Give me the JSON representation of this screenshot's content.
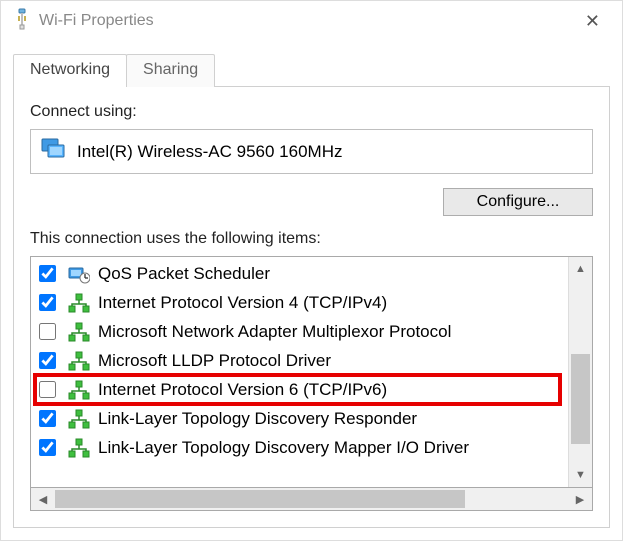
{
  "window": {
    "title": "Wi-Fi Properties",
    "close_glyph": "✕"
  },
  "tabs": {
    "networking": "Networking",
    "sharing": "Sharing"
  },
  "connect_label": "Connect using:",
  "adapter_name": "Intel(R) Wireless-AC 9560 160MHz",
  "configure_label": "Configure...",
  "items_label": "This connection uses the following items:",
  "items": [
    {
      "checked": true,
      "icon": "qos",
      "label": "QoS Packet Scheduler"
    },
    {
      "checked": true,
      "icon": "proto",
      "label": "Internet Protocol Version 4 (TCP/IPv4)"
    },
    {
      "checked": false,
      "icon": "proto",
      "label": "Microsoft Network Adapter Multiplexor Protocol"
    },
    {
      "checked": true,
      "icon": "proto",
      "label": "Microsoft LLDP Protocol Driver"
    },
    {
      "checked": false,
      "icon": "proto",
      "label": "Internet Protocol Version 6 (TCP/IPv6)"
    },
    {
      "checked": true,
      "icon": "proto",
      "label": "Link-Layer Topology Discovery Responder"
    },
    {
      "checked": true,
      "icon": "proto",
      "label": "Link-Layer Topology Discovery Mapper I/O Driver"
    }
  ],
  "highlight_index": 4,
  "glyphs": {
    "up": "▲",
    "down": "▼",
    "left": "◀",
    "right": "▶"
  }
}
